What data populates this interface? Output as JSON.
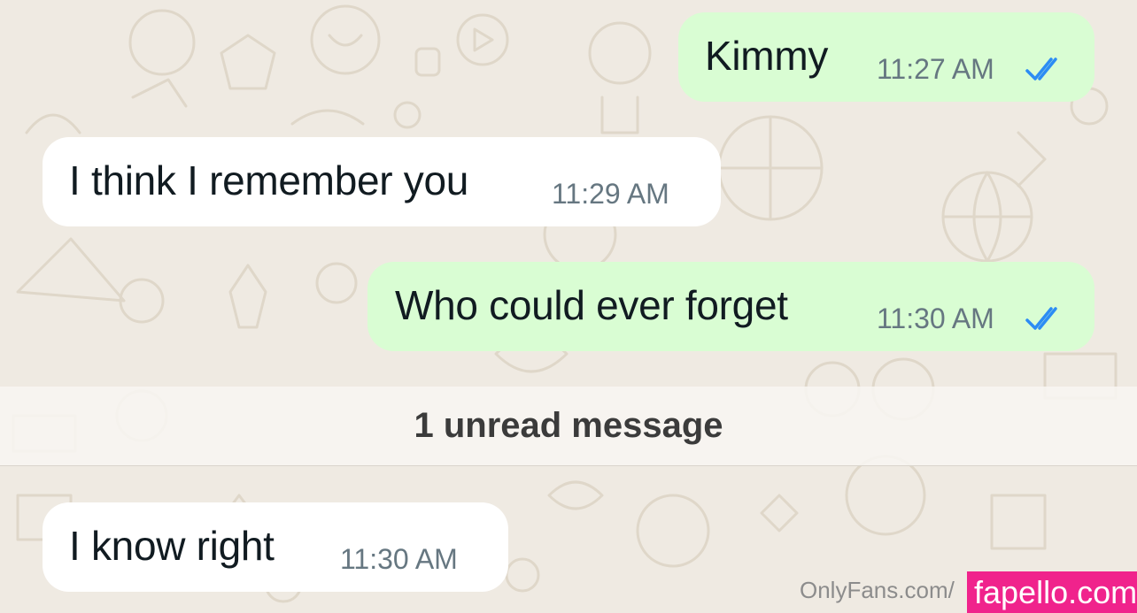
{
  "messages": [
    {
      "text": "Kimmy",
      "time": "11:27 AM",
      "direction": "outgoing",
      "status": "read"
    },
    {
      "text": "I think I remember you",
      "time": "11:29 AM",
      "direction": "incoming"
    },
    {
      "text": "Who could ever forget",
      "time": "11:30 AM",
      "direction": "outgoing",
      "status": "read"
    },
    {
      "text": "I know right",
      "time": "11:30 AM",
      "direction": "incoming"
    }
  ],
  "unread_divider": "1 unread message",
  "watermark": {
    "site_text": "OnlyFans.com/",
    "badge_text": "fapello.com"
  },
  "colors": {
    "outgoing_bubble": "#d9fdd3",
    "incoming_bubble": "#ffffff",
    "read_ticks": "#2c8cf4",
    "chat_background": "#efeae2",
    "watermark_badge": "#f0238c"
  }
}
